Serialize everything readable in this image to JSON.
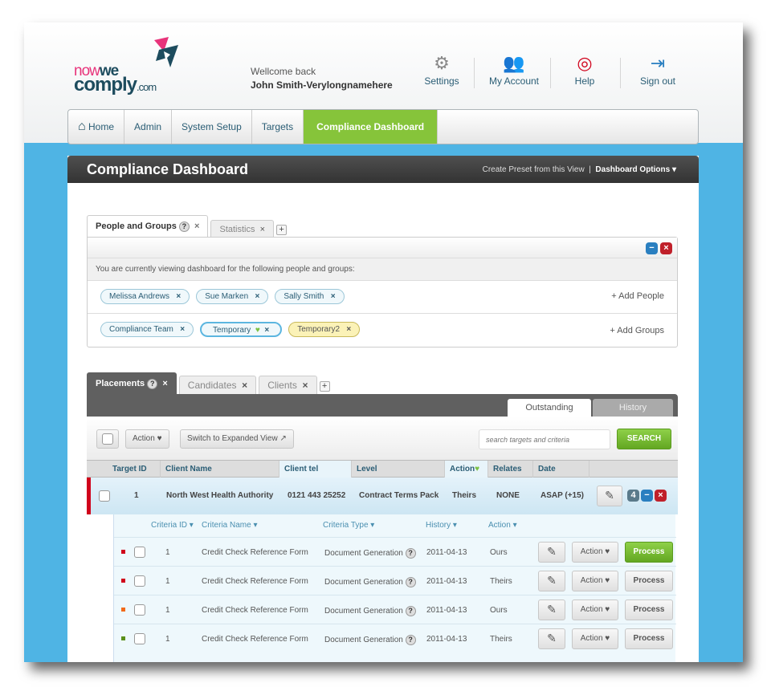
{
  "header": {
    "logo": {
      "now": "now",
      "we": "we",
      "comply": "comply",
      ".com": ".com"
    },
    "welcome": "Wellcome back",
    "user": "John Smith-Verylongnamehere",
    "nav": [
      {
        "label": "Settings",
        "icon": "gear-icon"
      },
      {
        "label": "My Account",
        "icon": "user-icon"
      },
      {
        "label": "Help",
        "icon": "lifebuoy-icon"
      },
      {
        "label": "Sign out",
        "icon": "door-exit-icon"
      }
    ]
  },
  "breadcrumb": [
    "Home",
    "Admin",
    "System Setup",
    "Targets",
    "Compliance Dashboard"
  ],
  "panel": {
    "title": "Compliance Dashboard",
    "preset": "Create Preset from this View",
    "options": "Dashboard Options ▾"
  },
  "pg": {
    "tabs": [
      "People and Groups",
      "Statistics"
    ],
    "notice": "You are currently viewing dashboard for the following people and groups:",
    "people": [
      "Melissa Andrews",
      "Sue Marken",
      "Sally Smith"
    ],
    "groups": [
      "Compliance Team",
      "Temporary",
      "Temporary2"
    ],
    "add_people": "+ Add People",
    "add_groups": "+ Add Groups"
  },
  "placements": {
    "tabs": [
      "Placements",
      "Candidates",
      "Clients"
    ],
    "subtabs": [
      "Outstanding",
      "History"
    ],
    "action": "Action",
    "expand": "Switch to Expanded View",
    "search_placeholder": "search targets and criteria",
    "search": "SEARCH",
    "columns": [
      "Target ID",
      "Client Name",
      "Client tel",
      "Level",
      "Action",
      "Relates",
      "Date"
    ],
    "row": {
      "id": "1",
      "client": "North West Health Authority",
      "tel": "0121 443 25252",
      "level": "Contract Terms Pack",
      "action": "Theirs",
      "relates": "NONE",
      "date": "ASAP (+15)",
      "count": "4"
    },
    "sub_columns": [
      "Criteria ID ▾",
      "Criteria Name ▾",
      "Criteria Type ▾",
      "History ▾",
      "Action ▾"
    ],
    "sub_rows": [
      {
        "flag": "#d0021b",
        "id": "1",
        "name": "Credit Check Reference Form",
        "type": "Document Generation",
        "history": "2011-04-13",
        "action": "Ours"
      },
      {
        "flag": "#d0021b",
        "id": "1",
        "name": "Credit Check Reference Form",
        "type": "Document Generation",
        "history": "2011-04-13",
        "action": "Theirs"
      },
      {
        "flag": "#f26a1b",
        "id": "1",
        "name": "Credit Check Reference Form",
        "type": "Document Generation",
        "history": "2011-04-13",
        "action": "Ours"
      },
      {
        "flag": "#5a8f1a",
        "id": "1",
        "name": "Credit Check Reference Form",
        "type": "Document Generation",
        "history": "2011-04-13",
        "action": "Theirs"
      }
    ],
    "row_action": "Action",
    "process": "Process"
  },
  "colors": {
    "accent": "#86c43a",
    "background": "#4fb4e4",
    "dark": "#444444"
  }
}
